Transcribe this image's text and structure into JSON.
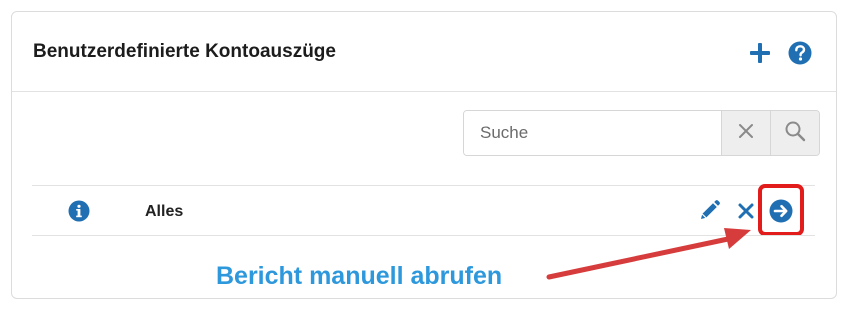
{
  "panel": {
    "title": "Benutzerdefinierte Kontoauszüge",
    "add_icon": "plus-icon",
    "help_icon": "question-circle-icon"
  },
  "search": {
    "placeholder": "Suche",
    "value": "",
    "clear_icon": "close-icon",
    "submit_icon": "search-icon"
  },
  "rows": [
    {
      "info_icon": "info-circle-icon",
      "label": "Alles",
      "actions": [
        "pencil-icon",
        "close-icon",
        "arrow-right-circle-icon"
      ]
    }
  ],
  "annotation": {
    "text": "Bericht manuell abrufen",
    "color": "#2e98dc",
    "highlight_color": "#e21b1b"
  },
  "colors": {
    "accent": "#1f6fb2"
  }
}
